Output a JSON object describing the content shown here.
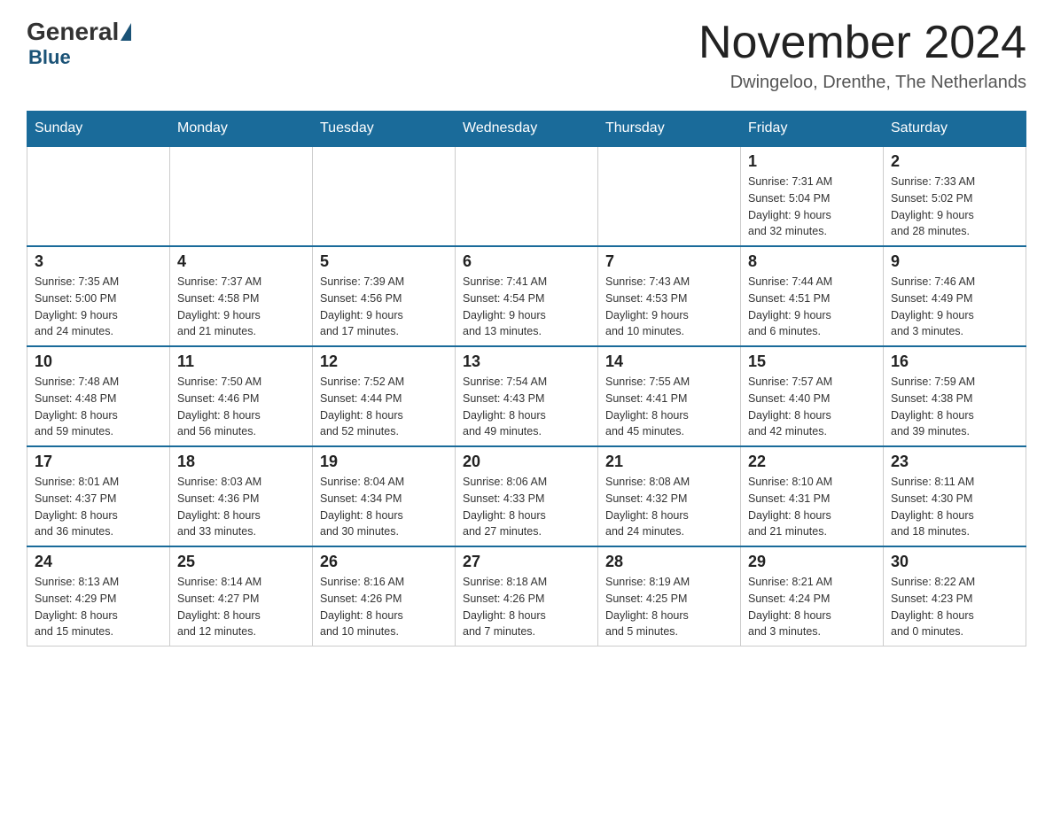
{
  "header": {
    "logo_general": "General",
    "logo_blue": "Blue",
    "month_title": "November 2024",
    "location": "Dwingeloo, Drenthe, The Netherlands"
  },
  "weekdays": [
    "Sunday",
    "Monday",
    "Tuesday",
    "Wednesday",
    "Thursday",
    "Friday",
    "Saturday"
  ],
  "weeks": [
    [
      {
        "day": "",
        "info": ""
      },
      {
        "day": "",
        "info": ""
      },
      {
        "day": "",
        "info": ""
      },
      {
        "day": "",
        "info": ""
      },
      {
        "day": "",
        "info": ""
      },
      {
        "day": "1",
        "info": "Sunrise: 7:31 AM\nSunset: 5:04 PM\nDaylight: 9 hours\nand 32 minutes."
      },
      {
        "day": "2",
        "info": "Sunrise: 7:33 AM\nSunset: 5:02 PM\nDaylight: 9 hours\nand 28 minutes."
      }
    ],
    [
      {
        "day": "3",
        "info": "Sunrise: 7:35 AM\nSunset: 5:00 PM\nDaylight: 9 hours\nand 24 minutes."
      },
      {
        "day": "4",
        "info": "Sunrise: 7:37 AM\nSunset: 4:58 PM\nDaylight: 9 hours\nand 21 minutes."
      },
      {
        "day": "5",
        "info": "Sunrise: 7:39 AM\nSunset: 4:56 PM\nDaylight: 9 hours\nand 17 minutes."
      },
      {
        "day": "6",
        "info": "Sunrise: 7:41 AM\nSunset: 4:54 PM\nDaylight: 9 hours\nand 13 minutes."
      },
      {
        "day": "7",
        "info": "Sunrise: 7:43 AM\nSunset: 4:53 PM\nDaylight: 9 hours\nand 10 minutes."
      },
      {
        "day": "8",
        "info": "Sunrise: 7:44 AM\nSunset: 4:51 PM\nDaylight: 9 hours\nand 6 minutes."
      },
      {
        "day": "9",
        "info": "Sunrise: 7:46 AM\nSunset: 4:49 PM\nDaylight: 9 hours\nand 3 minutes."
      }
    ],
    [
      {
        "day": "10",
        "info": "Sunrise: 7:48 AM\nSunset: 4:48 PM\nDaylight: 8 hours\nand 59 minutes."
      },
      {
        "day": "11",
        "info": "Sunrise: 7:50 AM\nSunset: 4:46 PM\nDaylight: 8 hours\nand 56 minutes."
      },
      {
        "day": "12",
        "info": "Sunrise: 7:52 AM\nSunset: 4:44 PM\nDaylight: 8 hours\nand 52 minutes."
      },
      {
        "day": "13",
        "info": "Sunrise: 7:54 AM\nSunset: 4:43 PM\nDaylight: 8 hours\nand 49 minutes."
      },
      {
        "day": "14",
        "info": "Sunrise: 7:55 AM\nSunset: 4:41 PM\nDaylight: 8 hours\nand 45 minutes."
      },
      {
        "day": "15",
        "info": "Sunrise: 7:57 AM\nSunset: 4:40 PM\nDaylight: 8 hours\nand 42 minutes."
      },
      {
        "day": "16",
        "info": "Sunrise: 7:59 AM\nSunset: 4:38 PM\nDaylight: 8 hours\nand 39 minutes."
      }
    ],
    [
      {
        "day": "17",
        "info": "Sunrise: 8:01 AM\nSunset: 4:37 PM\nDaylight: 8 hours\nand 36 minutes."
      },
      {
        "day": "18",
        "info": "Sunrise: 8:03 AM\nSunset: 4:36 PM\nDaylight: 8 hours\nand 33 minutes."
      },
      {
        "day": "19",
        "info": "Sunrise: 8:04 AM\nSunset: 4:34 PM\nDaylight: 8 hours\nand 30 minutes."
      },
      {
        "day": "20",
        "info": "Sunrise: 8:06 AM\nSunset: 4:33 PM\nDaylight: 8 hours\nand 27 minutes."
      },
      {
        "day": "21",
        "info": "Sunrise: 8:08 AM\nSunset: 4:32 PM\nDaylight: 8 hours\nand 24 minutes."
      },
      {
        "day": "22",
        "info": "Sunrise: 8:10 AM\nSunset: 4:31 PM\nDaylight: 8 hours\nand 21 minutes."
      },
      {
        "day": "23",
        "info": "Sunrise: 8:11 AM\nSunset: 4:30 PM\nDaylight: 8 hours\nand 18 minutes."
      }
    ],
    [
      {
        "day": "24",
        "info": "Sunrise: 8:13 AM\nSunset: 4:29 PM\nDaylight: 8 hours\nand 15 minutes."
      },
      {
        "day": "25",
        "info": "Sunrise: 8:14 AM\nSunset: 4:27 PM\nDaylight: 8 hours\nand 12 minutes."
      },
      {
        "day": "26",
        "info": "Sunrise: 8:16 AM\nSunset: 4:26 PM\nDaylight: 8 hours\nand 10 minutes."
      },
      {
        "day": "27",
        "info": "Sunrise: 8:18 AM\nSunset: 4:26 PM\nDaylight: 8 hours\nand 7 minutes."
      },
      {
        "day": "28",
        "info": "Sunrise: 8:19 AM\nSunset: 4:25 PM\nDaylight: 8 hours\nand 5 minutes."
      },
      {
        "day": "29",
        "info": "Sunrise: 8:21 AM\nSunset: 4:24 PM\nDaylight: 8 hours\nand 3 minutes."
      },
      {
        "day": "30",
        "info": "Sunrise: 8:22 AM\nSunset: 4:23 PM\nDaylight: 8 hours\nand 0 minutes."
      }
    ]
  ]
}
